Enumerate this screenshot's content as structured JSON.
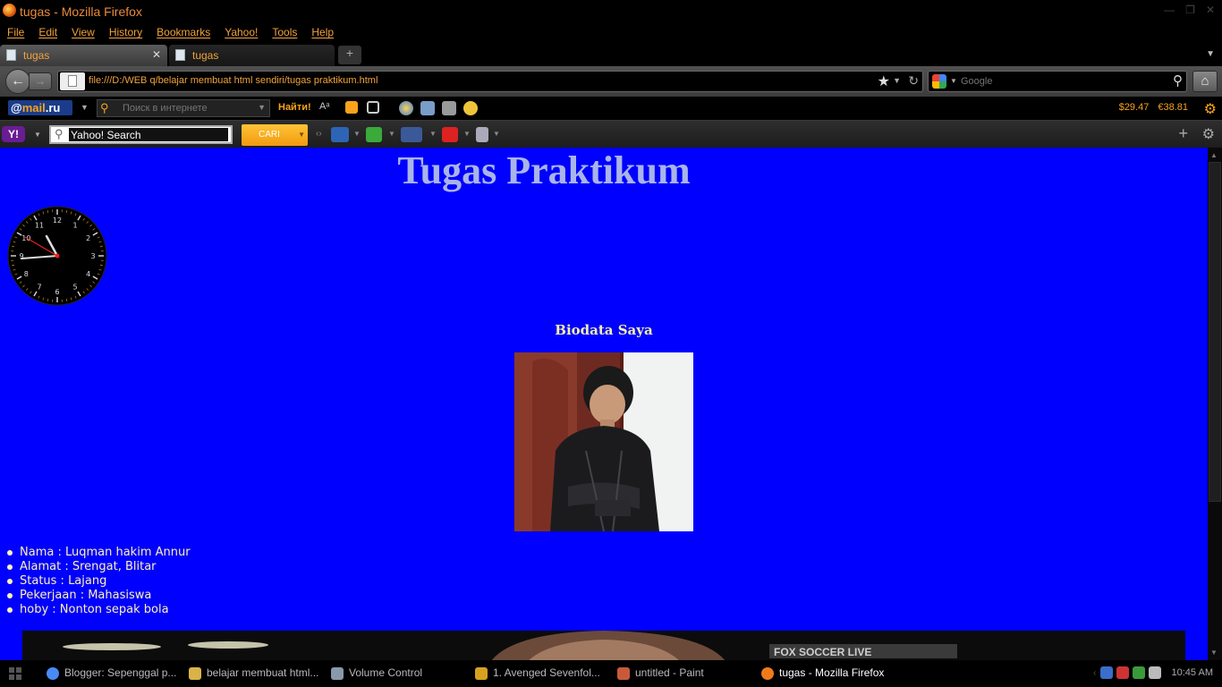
{
  "window": {
    "title": "tugas - Mozilla Firefox"
  },
  "menu": [
    "File",
    "Edit",
    "View",
    "History",
    "Bookmarks",
    "Yahoo!",
    "Tools",
    "Help"
  ],
  "tabs": [
    {
      "label": "tugas",
      "active": true
    },
    {
      "label": "tugas",
      "active": false
    }
  ],
  "nav": {
    "url": "file:///D:/WEB q/belajar membuat html sendiri/tugas praktikum.html",
    "search_placeholder": "Google"
  },
  "mailru_bar": {
    "logo_prefix": "@",
    "logo_main": "mail",
    "logo_suffix": ".ru",
    "search_placeholder": "Поиск в интернете",
    "find_label": "Найти!",
    "rate_usd": "29.47",
    "rate_eur": "38.81"
  },
  "yahoo_bar": {
    "logo": "Y!",
    "search_value": "Yahoo! Search",
    "cari_label": "CARI"
  },
  "page": {
    "title": "Tugas Praktikum",
    "bio_heading": "Biodata Saya",
    "bio": [
      "Nama : Luqman hakim Annur",
      "Alamat : Srengat, Blitar",
      "Status : Lajang",
      "Pekerjaan : Mahasiswa",
      "hoby : Nonton sepak bola"
    ],
    "video_banner_text": "FOX SOCCER LIVE"
  },
  "clock_numbers": [
    "12",
    "1",
    "2",
    "3",
    "4",
    "5",
    "6",
    "7",
    "8",
    "9",
    "10",
    "11"
  ],
  "taskbar": {
    "items": [
      {
        "label": "Blogger: Sepenggal p...",
        "color": "#4a8af4",
        "active": false
      },
      {
        "label": "belajar membuat html...",
        "color": "#d9b24a",
        "active": false
      },
      {
        "label": "Volume Control",
        "color": "#8899aa",
        "active": false
      },
      {
        "label": "1. Avenged Sevenfol...",
        "color": "#d6a020",
        "active": false
      },
      {
        "label": "untitled - Paint",
        "color": "#c85a3a",
        "active": false
      },
      {
        "label": "tugas - Mozilla Firefox",
        "color": "#f07a1a",
        "active": true
      }
    ],
    "time": "10:45 AM"
  },
  "colors": {
    "accent": "#f2a23a",
    "page_bg": "#0000ff",
    "title_color": "#a9b4e8",
    "bio_color": "#fff3b0"
  }
}
